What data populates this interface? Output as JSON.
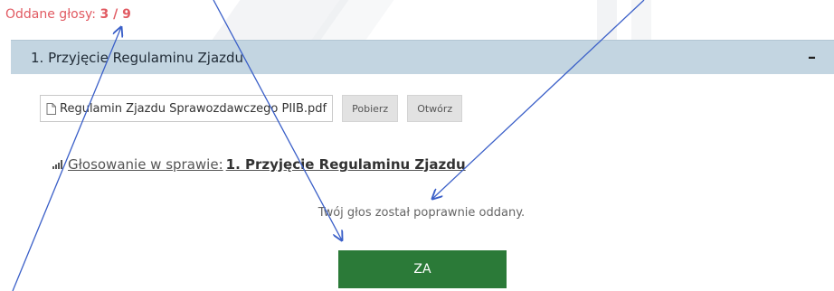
{
  "votes": {
    "label": "Oddane głosy:",
    "count": "3 / 9"
  },
  "section": {
    "title": "1. Przyjęcie Regulaminu Zjazdu",
    "collapse_symbol": "–"
  },
  "attachment": {
    "file_name": "Regulamin Zjazdu Sprawozdawczego  PIIB.pdf",
    "download_label": "Pobierz",
    "open_label": "Otwórz",
    "icon": "document-icon"
  },
  "voting": {
    "link_prefix": "Głosowanie w sprawie:",
    "link_subject": "1. Przyjęcie Regulaminu Zjazdu",
    "icon": "bar-chart-icon"
  },
  "confirmation": "Twój głos został poprawnie oddany.",
  "vote_button": "ZA",
  "colors": {
    "accent_red": "#e15a62",
    "header_bg": "#c3d5e1",
    "vote_green": "#2b7a38",
    "arrow_blue": "#3a5fc8"
  }
}
